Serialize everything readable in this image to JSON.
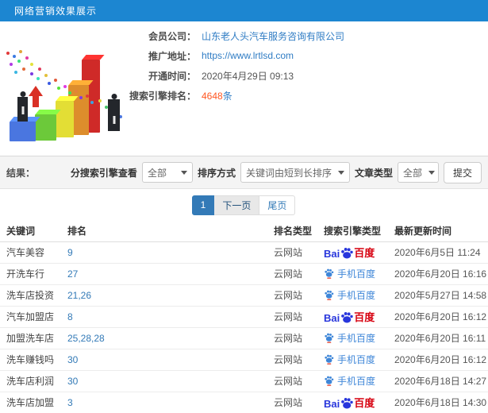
{
  "header": {
    "title": "网络营销效果展示"
  },
  "info": {
    "company_label": "会员公司：",
    "company_value": "山东老人头汽车服务咨询有限公司",
    "url_label": "推广地址：",
    "url_value": "https://www.lrtlsd.com",
    "open_label": "开通时间：",
    "open_value": "2020年4月29日 09:13",
    "rank_label": "搜索引擎排名：",
    "rank_value": "4648",
    "rank_unit": "条"
  },
  "filters": {
    "result_label": "结果：",
    "engine_label": "分搜索引擎查看",
    "engine_value": "全部",
    "sort_label": "排序方式",
    "sort_value": "关键词由短到长排序",
    "article_label": "文章类型",
    "article_value": "全部",
    "submit_label": "提交"
  },
  "pagination": {
    "current": "1",
    "next": "下一页",
    "last": "尾页"
  },
  "logos": {
    "baidu_prefix": "Bai",
    "baidu_suffix": "百度",
    "mobile_label": "手机百度"
  },
  "colors": {
    "topbar_blue": "#1c86d1",
    "link_blue": "#337ab7",
    "highlight_orange": "#ff5722",
    "baidu_blue": "#2836dc",
    "baidu_red": "#d7000f"
  },
  "table": {
    "headers": [
      "关键词",
      "排名",
      "排名类型",
      "搜索引擎类型",
      "最新更新时间"
    ],
    "rows": [
      {
        "keyword": "汽车美容",
        "rank": "9",
        "rank_type": "云网站",
        "engine": "baidu",
        "time": "2020年6月5日 11:24"
      },
      {
        "keyword": "开洗车行",
        "rank": "27",
        "rank_type": "云网站",
        "engine": "mobile-baidu",
        "time": "2020年6月20日 16:16"
      },
      {
        "keyword": "洗车店投资",
        "rank": "21,26",
        "rank_type": "云网站",
        "engine": "mobile-baidu",
        "time": "2020年5月27日 14:58"
      },
      {
        "keyword": "汽车加盟店",
        "rank": "8",
        "rank_type": "云网站",
        "engine": "baidu",
        "time": "2020年6月20日 16:12"
      },
      {
        "keyword": "加盟洗车店",
        "rank": "25,28,28",
        "rank_type": "云网站",
        "engine": "mobile-baidu",
        "time": "2020年6月20日 16:11"
      },
      {
        "keyword": "洗车赚钱吗",
        "rank": "30",
        "rank_type": "云网站",
        "engine": "mobile-baidu",
        "time": "2020年6月20日 16:12"
      },
      {
        "keyword": "洗车店利润",
        "rank": "30",
        "rank_type": "云网站",
        "engine": "mobile-baidu",
        "time": "2020年6月18日 14:27"
      },
      {
        "keyword": "洗车店加盟",
        "rank": "3",
        "rank_type": "云网站",
        "engine": "baidu",
        "time": "2020年6月18日 14:30"
      }
    ]
  }
}
